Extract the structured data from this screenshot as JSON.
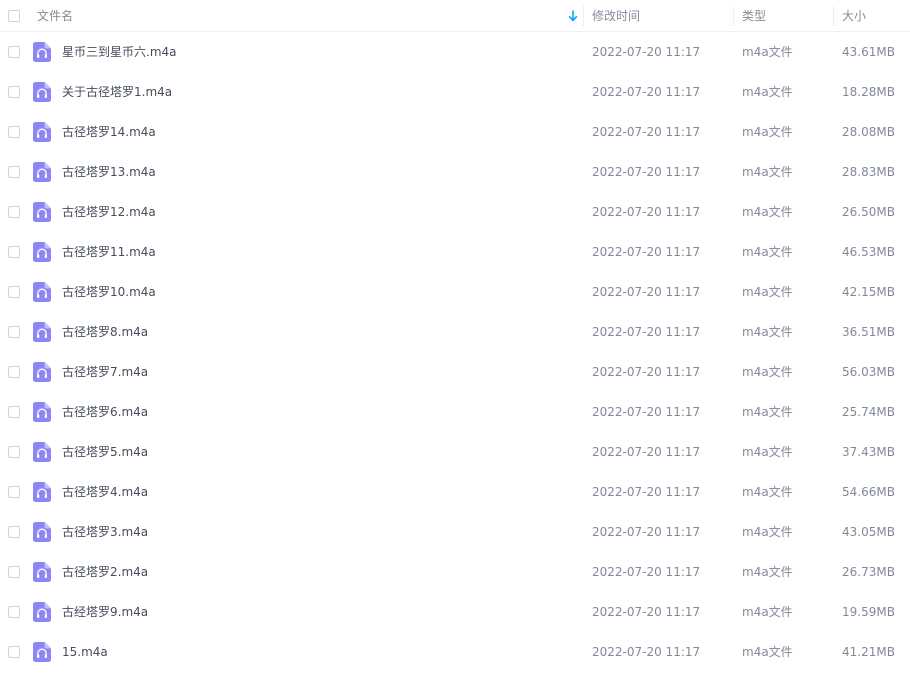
{
  "header": {
    "name_label": "文件名",
    "modified_label": "修改时间",
    "type_label": "类型",
    "size_label": "大小"
  },
  "icons": {
    "sort": "sort-descending-arrow-icon",
    "file": "audio-file-headphones-icon"
  },
  "colors": {
    "accent": "#06a7ff",
    "file_icon": "#8e86f5"
  },
  "files": [
    {
      "name": "星币三到星币六.m4a",
      "modified": "2022-07-20 11:17",
      "type": "m4a文件",
      "size": "43.61MB"
    },
    {
      "name": "关于古径塔罗1.m4a",
      "modified": "2022-07-20 11:17",
      "type": "m4a文件",
      "size": "18.28MB"
    },
    {
      "name": "古径塔罗14.m4a",
      "modified": "2022-07-20 11:17",
      "type": "m4a文件",
      "size": "28.08MB"
    },
    {
      "name": "古径塔罗13.m4a",
      "modified": "2022-07-20 11:17",
      "type": "m4a文件",
      "size": "28.83MB"
    },
    {
      "name": "古径塔罗12.m4a",
      "modified": "2022-07-20 11:17",
      "type": "m4a文件",
      "size": "26.50MB"
    },
    {
      "name": "古径塔罗11.m4a",
      "modified": "2022-07-20 11:17",
      "type": "m4a文件",
      "size": "46.53MB"
    },
    {
      "name": "古径塔罗10.m4a",
      "modified": "2022-07-20 11:17",
      "type": "m4a文件",
      "size": "42.15MB"
    },
    {
      "name": "古径塔罗8.m4a",
      "modified": "2022-07-20 11:17",
      "type": "m4a文件",
      "size": "36.51MB"
    },
    {
      "name": "古径塔罗7.m4a",
      "modified": "2022-07-20 11:17",
      "type": "m4a文件",
      "size": "56.03MB"
    },
    {
      "name": "古径塔罗6.m4a",
      "modified": "2022-07-20 11:17",
      "type": "m4a文件",
      "size": "25.74MB"
    },
    {
      "name": "古径塔罗5.m4a",
      "modified": "2022-07-20 11:17",
      "type": "m4a文件",
      "size": "37.43MB"
    },
    {
      "name": "古径塔罗4.m4a",
      "modified": "2022-07-20 11:17",
      "type": "m4a文件",
      "size": "54.66MB"
    },
    {
      "name": "古径塔罗3.m4a",
      "modified": "2022-07-20 11:17",
      "type": "m4a文件",
      "size": "43.05MB"
    },
    {
      "name": "古径塔罗2.m4a",
      "modified": "2022-07-20 11:17",
      "type": "m4a文件",
      "size": "26.73MB"
    },
    {
      "name": "古经塔罗9.m4a",
      "modified": "2022-07-20 11:17",
      "type": "m4a文件",
      "size": "19.59MB"
    },
    {
      "name": "15.m4a",
      "modified": "2022-07-20 11:17",
      "type": "m4a文件",
      "size": "41.21MB"
    }
  ]
}
